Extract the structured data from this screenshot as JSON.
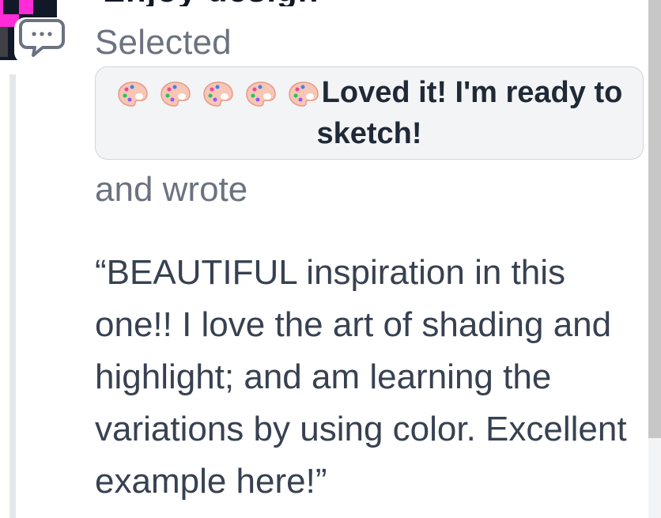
{
  "header": {
    "partial_heading": "Enjoy design"
  },
  "reaction": {
    "selected_label": "Selected",
    "selection_text": "Loved it! I'm ready to sketch!",
    "palette_icon_name": "palette-icon",
    "palette_count": 5,
    "wrote_label": "and wrote",
    "quote_text": "“BEAUTIFUL inspiration in this one!! I love the art of shading and highlight; and am learning the variations by using color. Excellent example here!”"
  },
  "colors": {
    "text_primary": "#374151",
    "text_secondary": "#6b7280",
    "selection_bg": "#f3f4f6",
    "selection_border": "#d1d5db",
    "rail": "#e5e7eb",
    "avatar_dark": "#111827",
    "avatar_pink": "#ff2bd6"
  }
}
